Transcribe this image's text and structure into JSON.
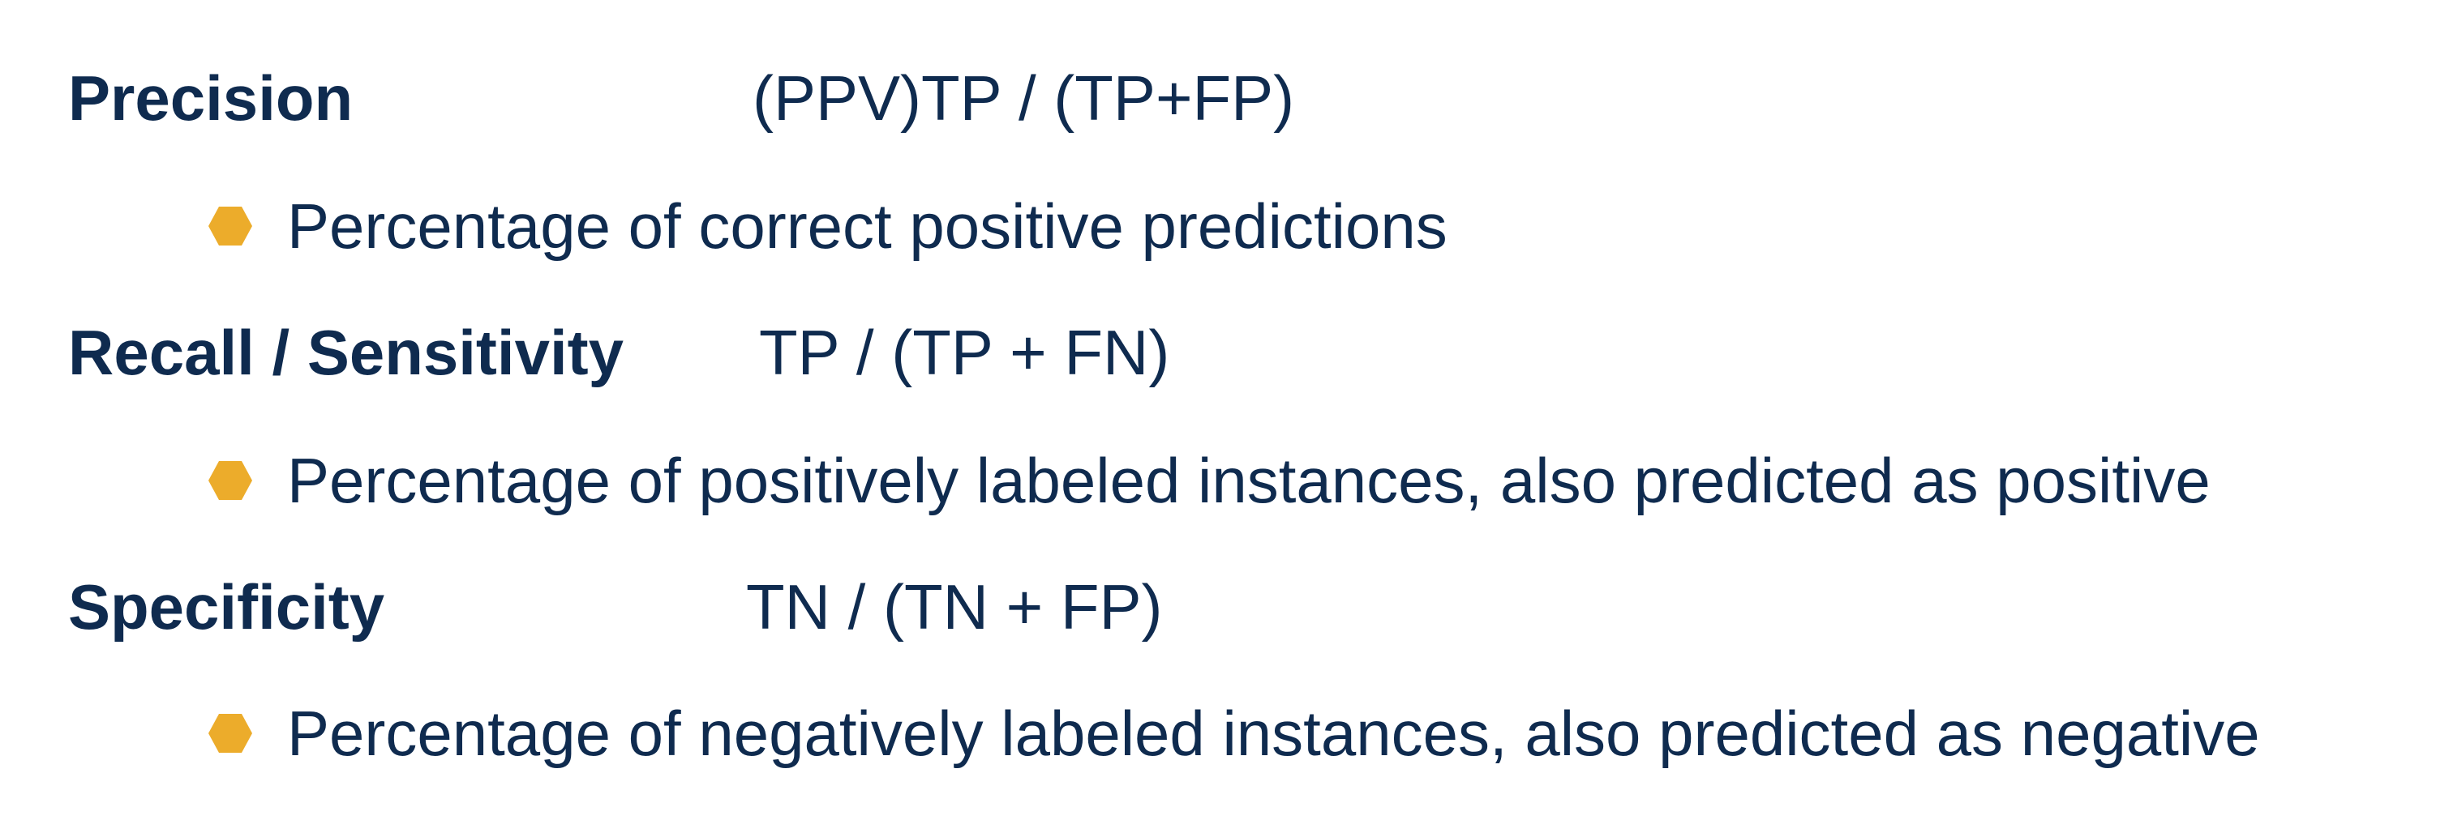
{
  "colors": {
    "text": "#0f2b4f",
    "bullet": "#ecac2b",
    "background": "#ffffff"
  },
  "bullet_icon": "hexagon-icon",
  "metrics": [
    {
      "term": "Precision",
      "formula": "(PPV)TP / (TP+FP)",
      "description": "Percentage of correct positive predictions"
    },
    {
      "term": "Recall / Sensitivity",
      "formula": "TP / (TP + FN)",
      "description": "Percentage of positively labeled instances, also predicted as positive"
    },
    {
      "term": "Specificity",
      "formula": "TN / (TN + FP)",
      "description": "Percentage of negatively labeled instances, also predicted as negative"
    }
  ]
}
